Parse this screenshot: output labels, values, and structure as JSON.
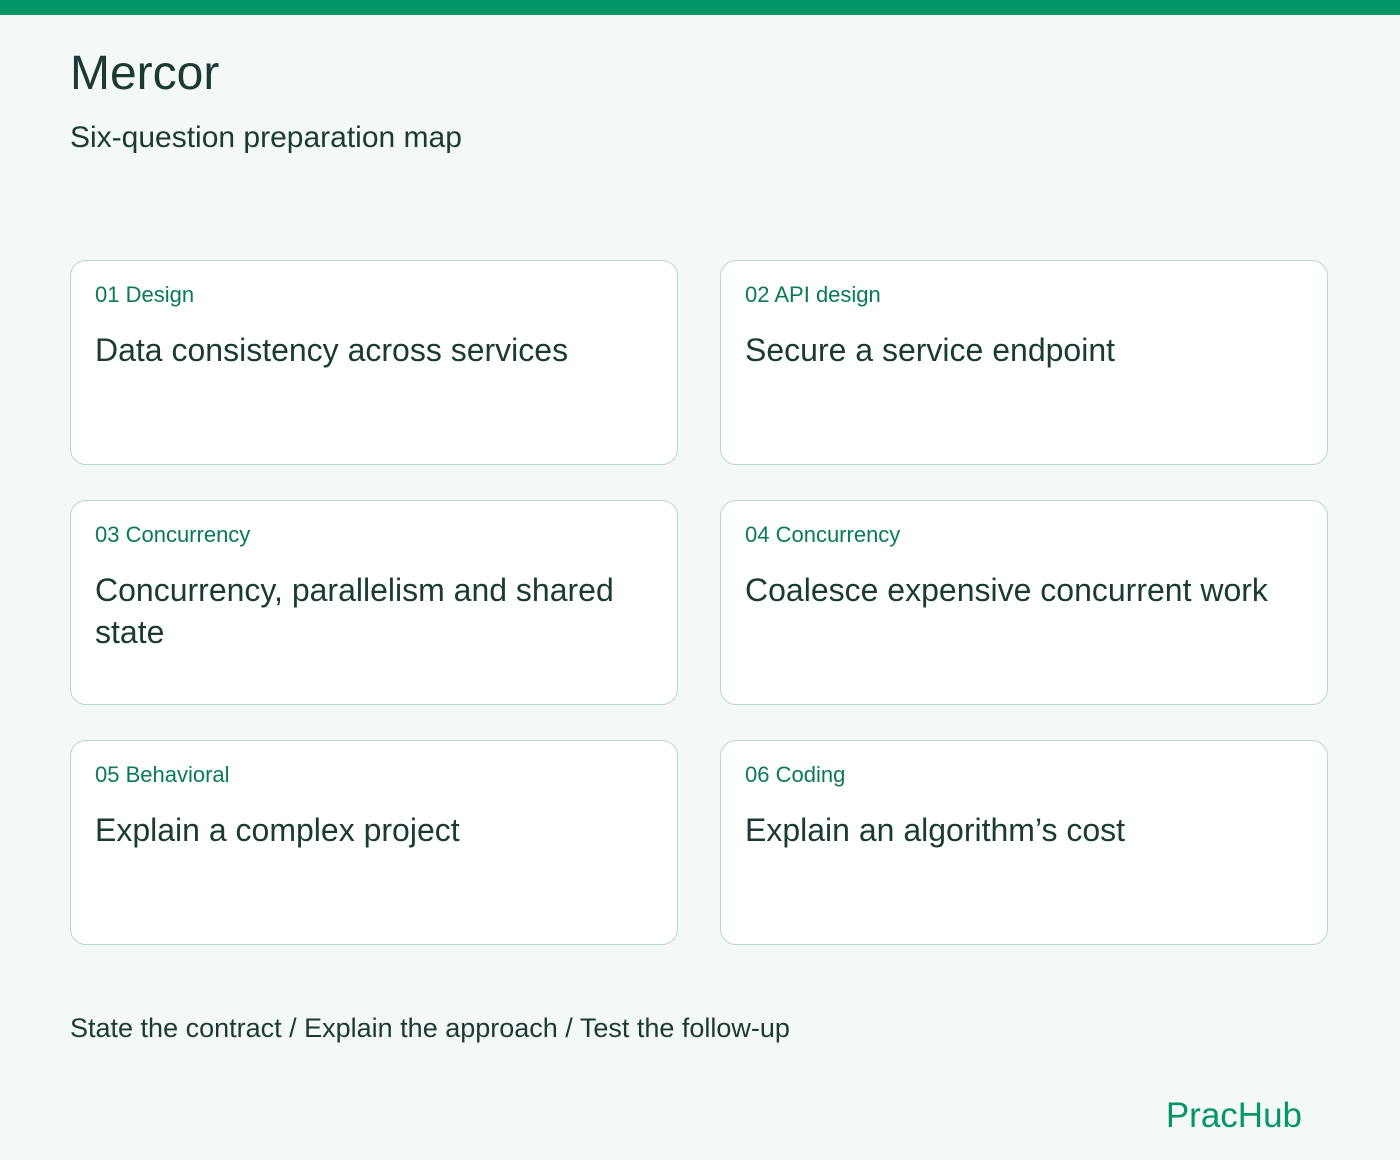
{
  "header": {
    "title": "Mercor",
    "subtitle": "Six-question preparation map"
  },
  "cards": [
    {
      "tag": "01 Design",
      "title": "Data consistency across services"
    },
    {
      "tag": "02 API design",
      "title": "Secure a service endpoint"
    },
    {
      "tag": "03 Concurrency",
      "title": "Concurrency, parallelism and shared state"
    },
    {
      "tag": "04 Concurrency",
      "title": "Coalesce expensive concurrent work"
    },
    {
      "tag": "05 Behavioral",
      "title": "Explain a complex project"
    },
    {
      "tag": "06 Coding",
      "title": "Explain an algorithm’s cost"
    }
  ],
  "footer": {
    "note": "State the contract / Explain the approach / Test the follow-up",
    "logo": "PracHub"
  },
  "colors": {
    "accent": "#049669",
    "text": "#1b3a34",
    "tag": "#087a58",
    "background": "#f4f8f6",
    "card_border": "#b9d8cc"
  }
}
